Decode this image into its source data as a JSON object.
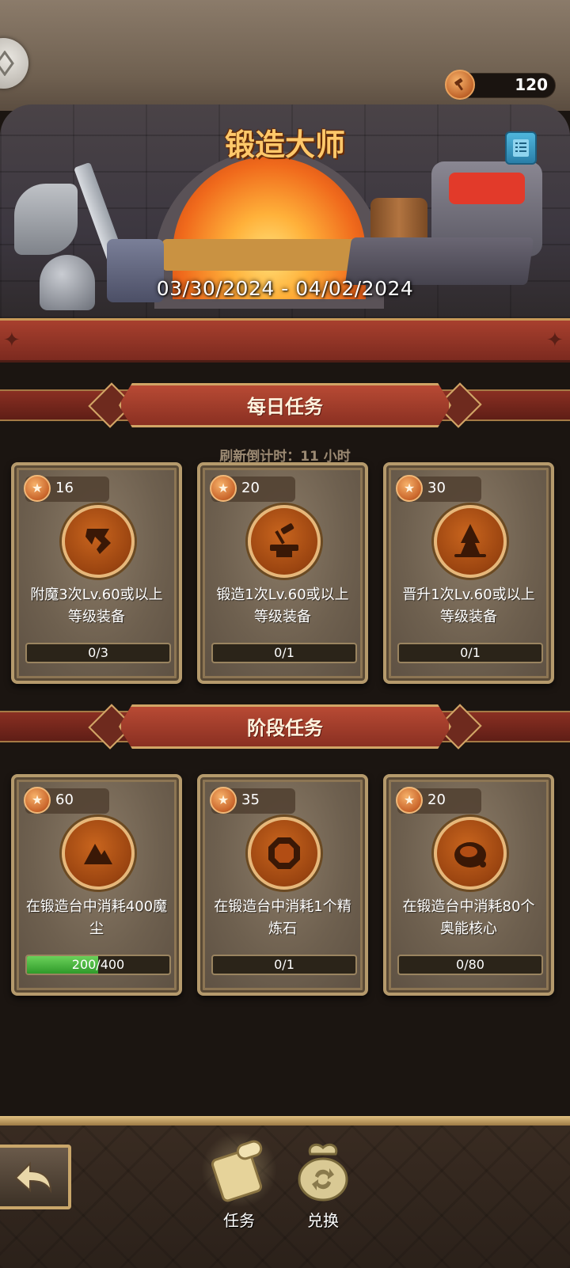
{
  "header": {
    "currency_value": "120"
  },
  "banner": {
    "title": "锻造大师",
    "dates": "03/30/2024 - 04/02/2024"
  },
  "daily": {
    "title": "每日任务",
    "refresh": "刷新倒计时：11 小时",
    "tasks": [
      {
        "points": "16",
        "desc_line1": "附魔3次Lv.60或以上",
        "desc_line2": "等级装备",
        "progress_text": "0/3",
        "progress": 0,
        "icon": "enchant-icon"
      },
      {
        "points": "20",
        "desc_line1": "锻造1次Lv.60或以上",
        "desc_line2": "等级装备",
        "progress_text": "0/1",
        "progress": 0,
        "icon": "forge-hammer-icon"
      },
      {
        "points": "30",
        "desc_line1": "晋升1次Lv.60或以上",
        "desc_line2": "等级装备",
        "progress_text": "0/1",
        "progress": 0,
        "icon": "promote-icon"
      }
    ]
  },
  "stage": {
    "title": "阶段任务",
    "tasks": [
      {
        "points": "60",
        "desc_line1": "在锻造台中消耗400魔",
        "desc_line2": "尘",
        "progress_text": "200/400",
        "progress": 0.5,
        "icon": "magic-dust-icon"
      },
      {
        "points": "35",
        "desc_line1": "在锻造台中消耗1个精",
        "desc_line2": "炼石",
        "progress_text": "0/1",
        "progress": 0,
        "icon": "refining-stone-icon"
      },
      {
        "points": "20",
        "desc_line1": "在锻造台中消耗80个",
        "desc_line2": "奥能核心",
        "progress_text": "0/80",
        "progress": 0,
        "icon": "arcane-core-icon"
      }
    ]
  },
  "nav": {
    "tasks_label": "任务",
    "exchange_label": "兑换"
  },
  "colors": {
    "accent_gold": "#ffc86a",
    "progress_green": "#2f9a2a",
    "ribbon_red": "#8a2f22"
  }
}
